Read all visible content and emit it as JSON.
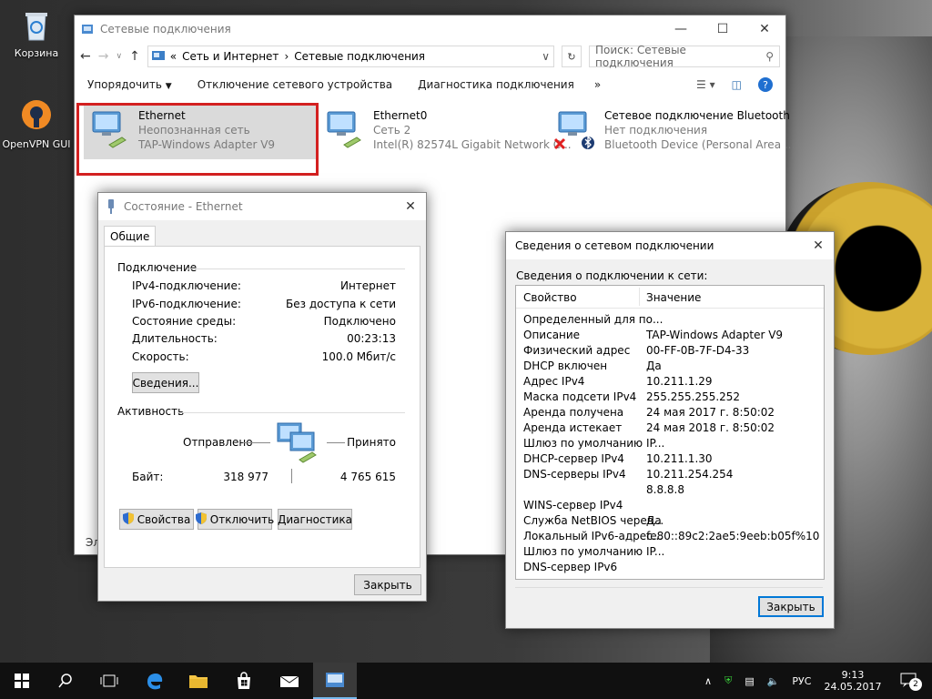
{
  "desktop": {
    "icons": [
      {
        "label": "Корзина"
      },
      {
        "label": "OpenVPN GUI"
      }
    ]
  },
  "explorer": {
    "title": "Сетевые подключения",
    "breadcrumb": {
      "prefix": "«",
      "part1": "Сеть и Интернет",
      "sep": "›",
      "part2": "Сетевые подключения"
    },
    "search_placeholder": "Поиск: Сетевые подключения",
    "commands": {
      "organize": "Упорядочить",
      "disable": "Отключение сетевого устройства",
      "diagnose": "Диагностика подключения",
      "more": "»"
    },
    "status_fragment": "Эле",
    "adapters": [
      {
        "name": "Ethernet",
        "status": "Неопознанная сеть",
        "device": "TAP-Windows Adapter V9"
      },
      {
        "name": "Ethernet0",
        "status": "Сеть  2",
        "device": "Intel(R) 82574L Gigabit Network C..."
      },
      {
        "name": "Сетевое подключение Bluetooth",
        "status": "Нет подключения",
        "device": "Bluetooth Device (Personal Area ..."
      }
    ],
    "highlight_color": "#d32020"
  },
  "status_dialog": {
    "title": "Состояние - Ethernet",
    "tab": "Общие",
    "connection_group": "Подключение",
    "rows": [
      {
        "label": "IPv4-подключение:",
        "value": "Интернет"
      },
      {
        "label": "IPv6-подключение:",
        "value": "Без доступа к сети"
      },
      {
        "label": "Состояние среды:",
        "value": "Подключено"
      },
      {
        "label": "Длительность:",
        "value": "00:23:13"
      },
      {
        "label": "Скорость:",
        "value": "100.0 Мбит/с"
      }
    ],
    "details_button": "Сведения...",
    "activity_group": "Активность",
    "sent_label": "Отправлено",
    "received_label": "Принято",
    "bytes_label": "Байт:",
    "bytes_sent": "318 977",
    "bytes_received": "4 765 615",
    "properties_button": "Свойства",
    "disable_button": "Отключить",
    "diagnose_button": "Диагностика",
    "close_button": "Закрыть"
  },
  "details_dialog": {
    "title": "Сведения о сетевом подключении",
    "caption": "Сведения о подключении к сети:",
    "col_property": "Свойство",
    "col_value": "Значение",
    "rows": [
      {
        "p": "Определенный для по...",
        "v": ""
      },
      {
        "p": "Описание",
        "v": "TAP-Windows Adapter V9"
      },
      {
        "p": "Физический адрес",
        "v": "00-FF-0B-7F-D4-33"
      },
      {
        "p": "DHCP включен",
        "v": "Да"
      },
      {
        "p": "Адрес IPv4",
        "v": "10.211.1.29"
      },
      {
        "p": "Маска подсети IPv4",
        "v": "255.255.255.252"
      },
      {
        "p": "Аренда получена",
        "v": "24 мая 2017 г. 8:50:02"
      },
      {
        "p": "Аренда истекает",
        "v": "24 мая 2018 г. 8:50:02"
      },
      {
        "p": "Шлюз по умолчанию IP...",
        "v": ""
      },
      {
        "p": "DHCP-сервер IPv4",
        "v": "10.211.1.30"
      },
      {
        "p": "DNS-серверы IPv4",
        "v": "10.211.254.254"
      },
      {
        "p": "",
        "v": "8.8.8.8"
      },
      {
        "p": "WINS-сервер IPv4",
        "v": ""
      },
      {
        "p": "Служба NetBIOS черев...",
        "v": "Да"
      },
      {
        "p": "Локальный IPv6-адрес...",
        "v": "fe80::89c2:2ae5:9eeb:b05f%10"
      },
      {
        "p": "Шлюз по умолчанию IP...",
        "v": ""
      },
      {
        "p": "DNS-сервер IPv6",
        "v": ""
      }
    ],
    "close_button": "Закрыть"
  },
  "taskbar": {
    "language": "РУС",
    "time": "9:13",
    "date": "24.05.2017",
    "notification_count": "2"
  }
}
